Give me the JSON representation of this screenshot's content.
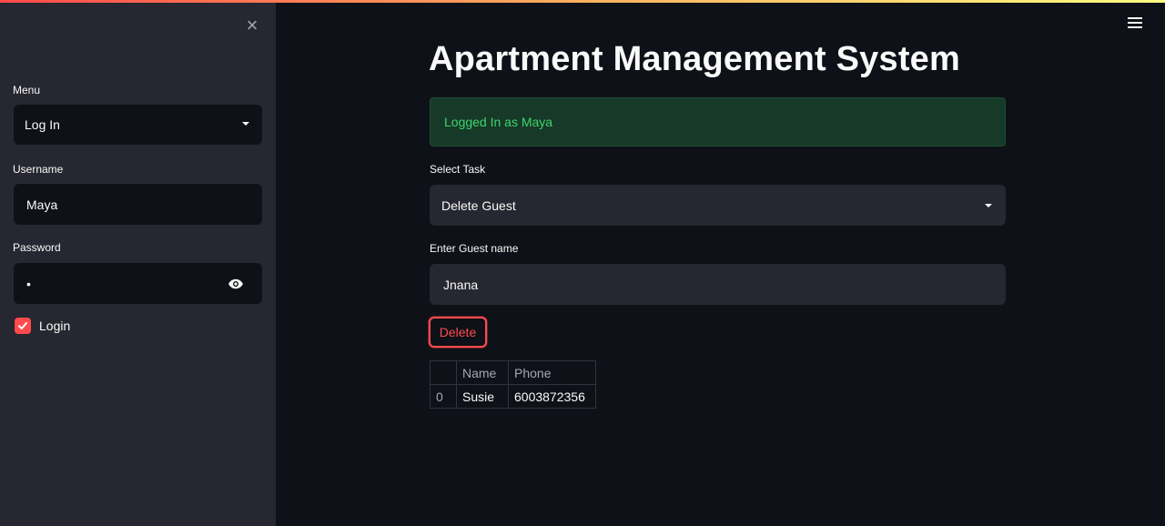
{
  "sidebar": {
    "close_icon": "×",
    "menu_label": "Menu",
    "menu_selected": "Log In",
    "username_label": "Username",
    "username_value": "Maya",
    "password_label": "Password",
    "password_value": "•",
    "login_checkbox_label": "Login",
    "login_checked": true
  },
  "header": {
    "title": "Apartment Management System"
  },
  "main": {
    "success_message": "Logged In as Maya",
    "task_label": "Select Task",
    "task_selected": "Delete Guest",
    "guest_label": "Enter Guest name",
    "guest_value": "Jnana",
    "delete_button": "Delete",
    "table": {
      "columns": [
        "",
        "Name",
        "Phone"
      ],
      "rows": [
        {
          "index": "0",
          "name": "Susie",
          "phone": "6003872356"
        }
      ]
    }
  },
  "colors": {
    "accent": "#ff4b4b",
    "background": "#0e1117",
    "sidebar": "#262730",
    "success_text": "#3dd56d",
    "success_bg": "#173928"
  }
}
